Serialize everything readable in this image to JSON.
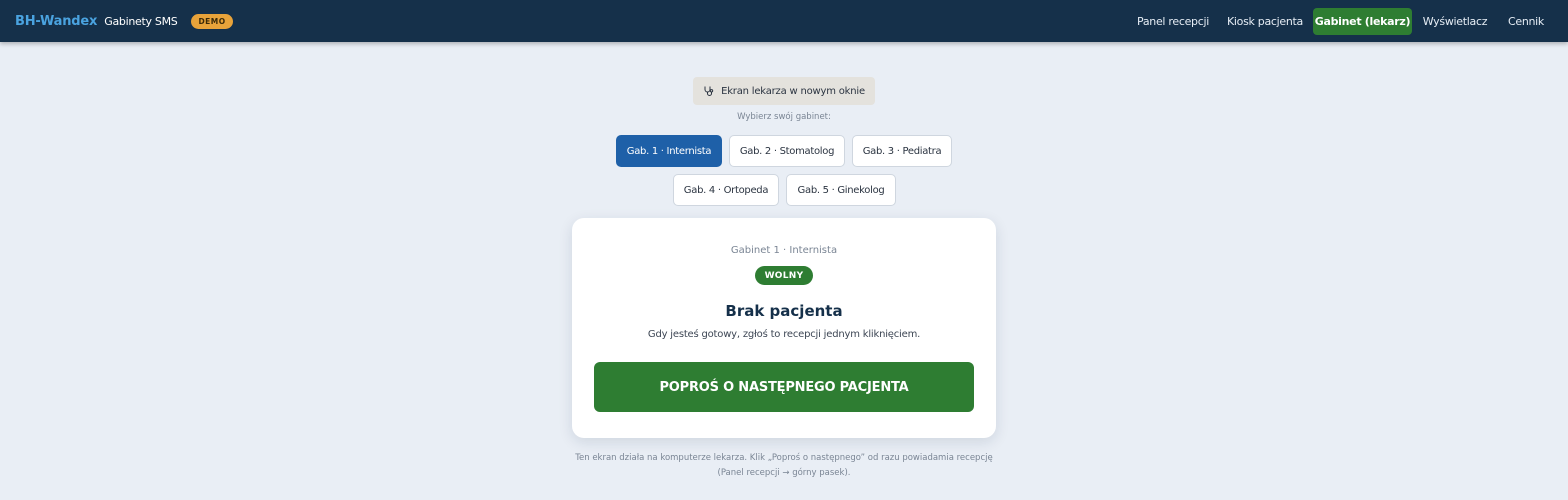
{
  "header": {
    "brand_name": "BH-Wandex",
    "brand_sub": "Gabinety SMS",
    "badge": "DEMO",
    "nav": [
      {
        "label": "Panel recepcji",
        "active": false
      },
      {
        "label": "Kiosk pacjenta",
        "active": false
      },
      {
        "label": "Gabinet (lekarz)",
        "active": true
      },
      {
        "label": "Wyświetlacz",
        "active": false
      },
      {
        "label": "Cennik",
        "active": false
      }
    ]
  },
  "main": {
    "open_window_label": "Ekran lekarza w nowym oknie",
    "open_window_icon": "stethoscope-icon",
    "choose_label": "Wybierz swój gabinet:",
    "offices": [
      {
        "label": "Gab. 1 · Internista",
        "active": true
      },
      {
        "label": "Gab. 2 · Stomatolog",
        "active": false
      },
      {
        "label": "Gab. 3 · Pediatra",
        "active": false
      },
      {
        "label": "Gab. 4 · Ortopeda",
        "active": false
      },
      {
        "label": "Gab. 5 · Ginekolog",
        "active": false
      }
    ],
    "card": {
      "subtitle": "Gabinet 1 · Internista",
      "status": "WOLNY",
      "title": "Brak pacjenta",
      "description": "Gdy jesteś gotowy, zgłoś to recepcji jednym kliknięciem.",
      "button": "POPROŚ O NASTĘPNEGO PACJENTA"
    },
    "footnote_line1": "Ten ekran działa na komputerze lekarza. Klik „Poproś o następnego” od razu powiadamia recepcję",
    "footnote_line2": "(Panel recepcji → górny pasek)."
  },
  "colors": {
    "topbar": "#15304a",
    "brand": "#4aa3e0",
    "accent_green": "#2e7d32",
    "active_blue": "#1e60a8",
    "demo_badge": "#e8a33a",
    "background": "#e9eef5"
  }
}
